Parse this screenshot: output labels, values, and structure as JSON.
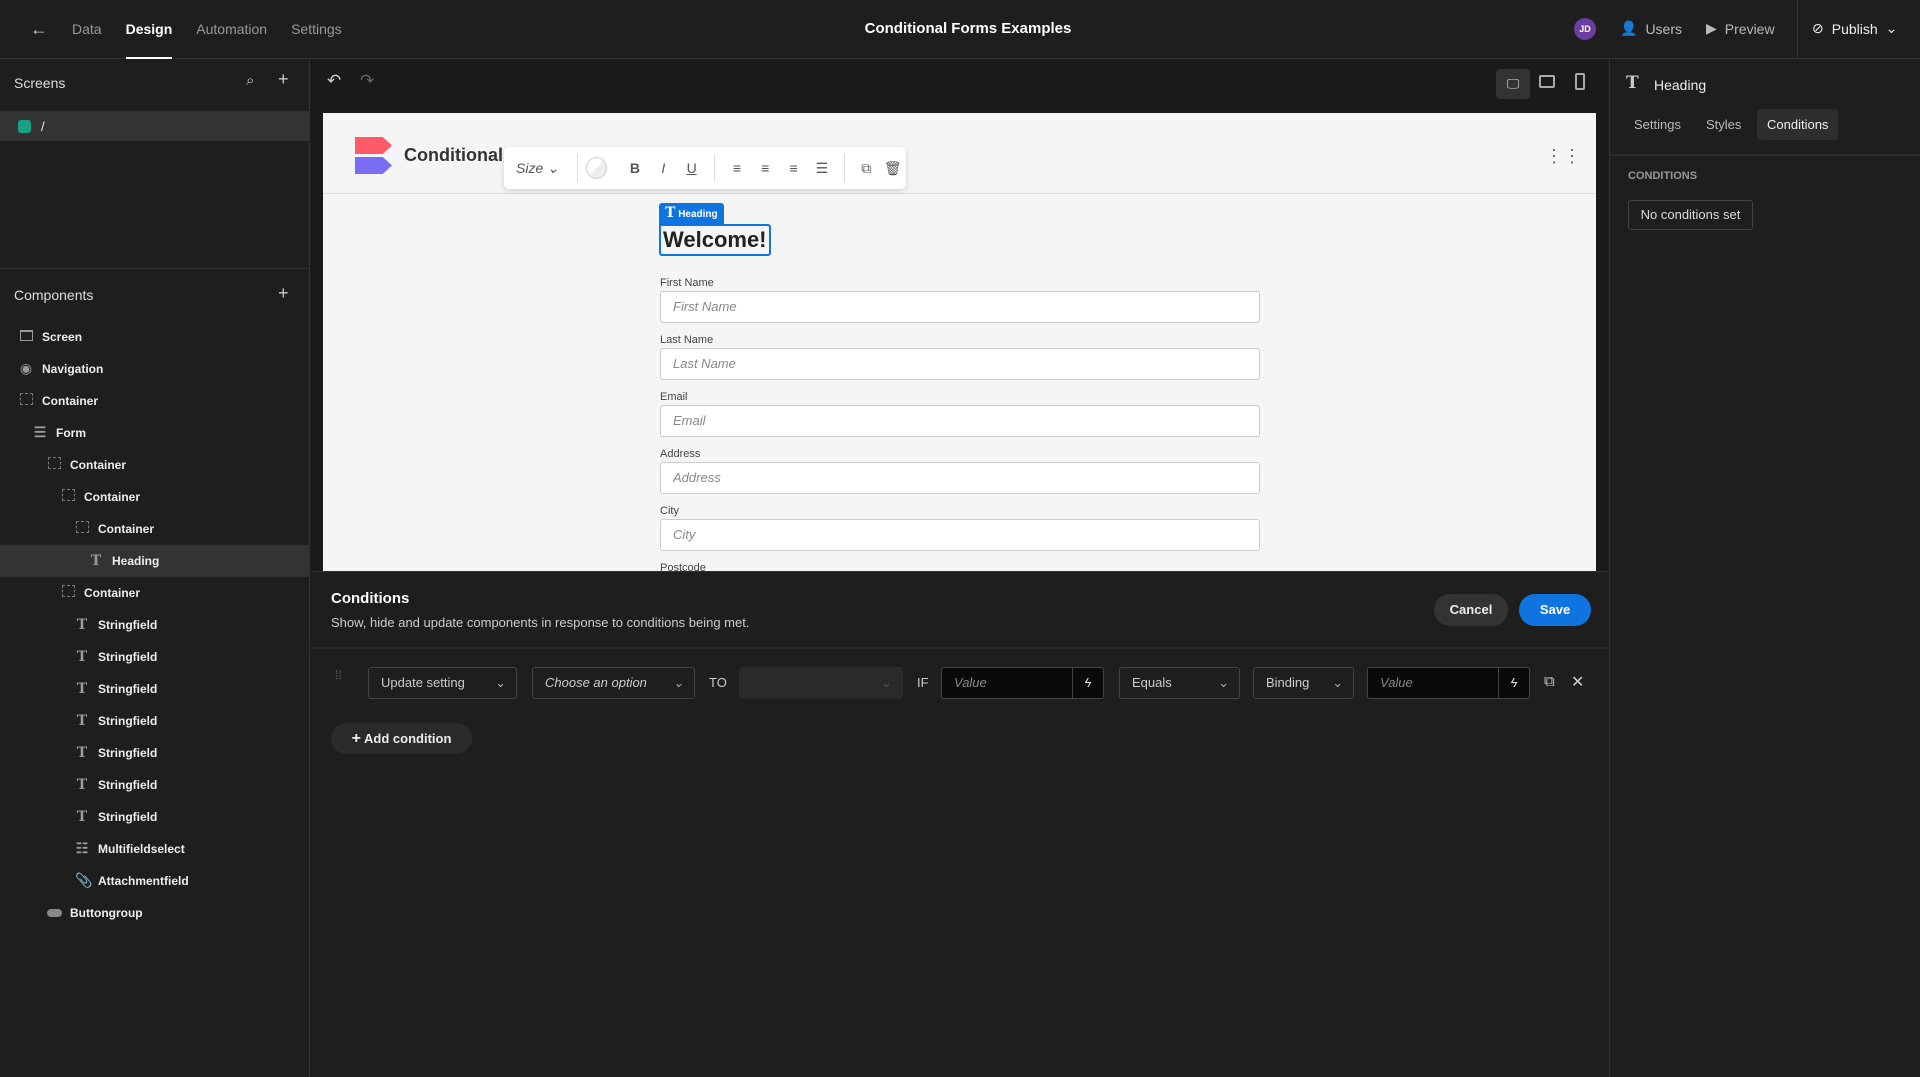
{
  "topbar": {
    "tabs": [
      "Data",
      "Design",
      "Automation",
      "Settings"
    ],
    "active_tab": "Design",
    "title": "Conditional Forms Examples",
    "avatar": "JD",
    "users": "Users",
    "preview": "Preview",
    "publish": "Publish"
  },
  "screens": {
    "title": "Screens",
    "items": [
      {
        "label": "/",
        "color": "#16a085"
      }
    ]
  },
  "components": {
    "title": "Components",
    "items": [
      {
        "label": "Screen",
        "icon": "screen-icon",
        "level": 0
      },
      {
        "label": "Navigation",
        "icon": "eye-icon",
        "level": 0
      },
      {
        "label": "Container",
        "icon": "container-icon",
        "level": 0
      },
      {
        "label": "Form",
        "icon": "form-icon",
        "level": 1
      },
      {
        "label": "Container",
        "icon": "container-icon",
        "level": 2
      },
      {
        "label": "Container",
        "icon": "container-icon",
        "level": 3
      },
      {
        "label": "Container",
        "icon": "container-icon",
        "level": 4
      },
      {
        "label": "Heading",
        "icon": "text-icon",
        "level": 5,
        "selected": true
      },
      {
        "label": "Container",
        "icon": "container-icon",
        "level": 3
      },
      {
        "label": "Stringfield",
        "icon": "text-icon",
        "level": 4
      },
      {
        "label": "Stringfield",
        "icon": "text-icon",
        "level": 4
      },
      {
        "label": "Stringfield",
        "icon": "text-icon",
        "level": 4
      },
      {
        "label": "Stringfield",
        "icon": "text-icon",
        "level": 4
      },
      {
        "label": "Stringfield",
        "icon": "text-icon",
        "level": 4
      },
      {
        "label": "Stringfield",
        "icon": "text-icon",
        "level": 4
      },
      {
        "label": "Stringfield",
        "icon": "text-icon",
        "level": 4
      },
      {
        "label": "Multifieldselect",
        "icon": "list-icon",
        "level": 4
      },
      {
        "label": "Attachmentfield",
        "icon": "paperclip-icon",
        "level": 4
      },
      {
        "label": "Buttongroup",
        "icon": "button-icon",
        "level": 2
      }
    ]
  },
  "preview": {
    "app_title": "Conditional F",
    "toolbar": {
      "size": "Size",
      "bold": "B",
      "italic": "I",
      "underline": "U"
    },
    "badge": "Heading",
    "heading": "Welcome!",
    "fields": [
      {
        "label": "First Name",
        "placeholder": "First Name"
      },
      {
        "label": "Last Name",
        "placeholder": "Last Name"
      },
      {
        "label": "Email",
        "placeholder": "Email"
      },
      {
        "label": "Address",
        "placeholder": "Address"
      },
      {
        "label": "City",
        "placeholder": "City"
      },
      {
        "label": "Postcode",
        "placeholder": ""
      }
    ]
  },
  "conditions": {
    "title": "Conditions",
    "subtitle": "Show, hide and update components in response to conditions being met.",
    "cancel": "Cancel",
    "save": "Save",
    "row": {
      "action": "Update setting",
      "setting": "Choose an option",
      "to": "TO",
      "to_value": "",
      "if": "IF",
      "value1": "Value",
      "operator": "Equals",
      "type": "Binding",
      "value2": "Value"
    },
    "add": "Add condition"
  },
  "right": {
    "component": "Heading",
    "tabs": [
      "Settings",
      "Styles",
      "Conditions"
    ],
    "active_tab": "Conditions",
    "section": "CONDITIONS",
    "none": "No conditions set"
  },
  "colors": {
    "accent": "#0f74e0",
    "bg": "#1e1e1e"
  }
}
